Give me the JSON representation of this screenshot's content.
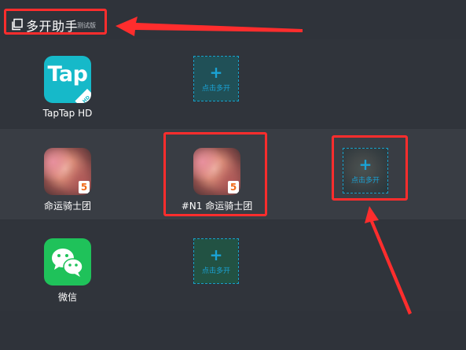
{
  "header": {
    "title": "多开助手",
    "badge": "测试版"
  },
  "apps": [
    {
      "label": "TapTap HD",
      "icon": "taptap-hd-icon",
      "icon_text": "Tap",
      "icon_tag": "HD"
    },
    {
      "label": "命运骑士团",
      "icon": "game-icon",
      "icon_badge": "5"
    },
    {
      "label": "微信",
      "icon": "wechat-icon"
    }
  ],
  "clones": {
    "existing_label": "#N1 命运骑士团",
    "add_label": "点击多开",
    "plus": "+"
  },
  "colors": {
    "background": "#2f333a",
    "row_alt": "#393d44",
    "accent": "#1aa3d6",
    "annotation": "#ff2d2d"
  }
}
